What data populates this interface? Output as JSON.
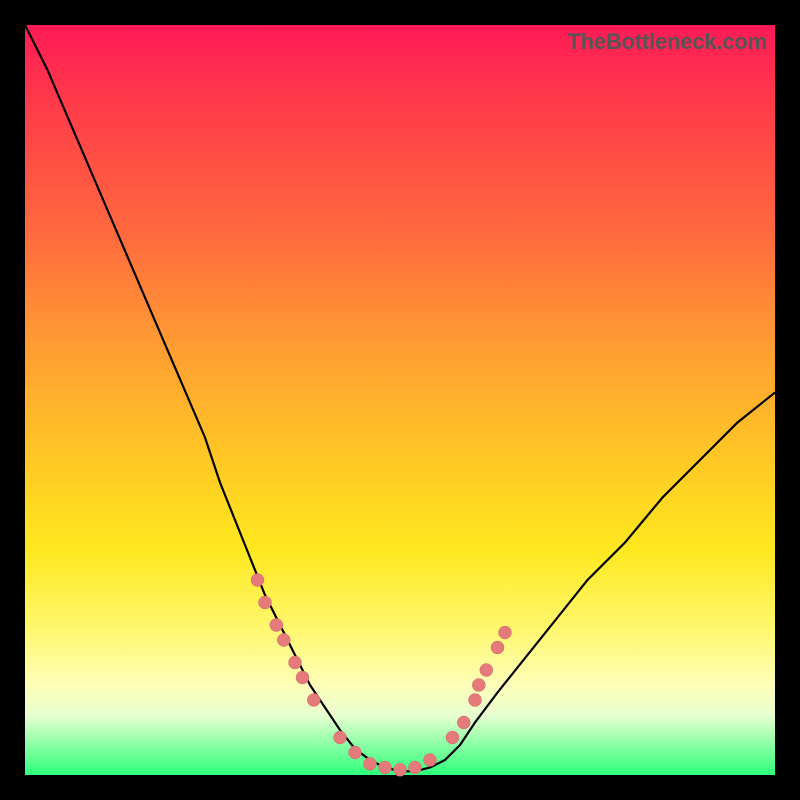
{
  "attribution": "TheBottleneck.com",
  "colors": {
    "curve_stroke": "#000000",
    "dot_fill": "#e47a7a",
    "dot_stroke": "#d46a6a"
  },
  "chart_data": {
    "type": "line",
    "title": "",
    "xlabel": "",
    "ylabel": "",
    "xlim": [
      0,
      100
    ],
    "ylim": [
      0,
      100
    ],
    "x": [
      0,
      3,
      6,
      9,
      12,
      15,
      18,
      21,
      24,
      26,
      28,
      30,
      32,
      34,
      36,
      38,
      40,
      42,
      44,
      46,
      48,
      50,
      52,
      54,
      56,
      58,
      60,
      63,
      67,
      71,
      75,
      80,
      85,
      90,
      95,
      100
    ],
    "values": [
      100,
      94,
      87,
      80,
      73,
      66,
      59,
      52,
      45,
      39,
      34,
      29,
      24,
      20,
      16,
      12,
      9,
      6,
      3.5,
      2,
      1,
      0.5,
      0.5,
      1,
      2,
      4,
      7,
      11,
      16,
      21,
      26,
      31,
      37,
      42,
      47,
      51
    ],
    "markers": {
      "left_cluster": [
        {
          "x": 31,
          "y": 26
        },
        {
          "x": 32,
          "y": 23
        },
        {
          "x": 33.5,
          "y": 20
        },
        {
          "x": 34.5,
          "y": 18
        },
        {
          "x": 36,
          "y": 15
        },
        {
          "x": 37,
          "y": 13
        },
        {
          "x": 38.5,
          "y": 10
        }
      ],
      "valley_cluster": [
        {
          "x": 42,
          "y": 5
        },
        {
          "x": 44,
          "y": 3
        },
        {
          "x": 46,
          "y": 1.5
        },
        {
          "x": 48,
          "y": 1
        },
        {
          "x": 50,
          "y": 0.7
        },
        {
          "x": 52,
          "y": 1
        },
        {
          "x": 54,
          "y": 2
        }
      ],
      "right_cluster": [
        {
          "x": 57,
          "y": 5
        },
        {
          "x": 58.5,
          "y": 7
        },
        {
          "x": 60,
          "y": 10
        },
        {
          "x": 60.5,
          "y": 12
        },
        {
          "x": 61.5,
          "y": 14
        },
        {
          "x": 63,
          "y": 17
        },
        {
          "x": 64,
          "y": 19
        }
      ]
    }
  }
}
